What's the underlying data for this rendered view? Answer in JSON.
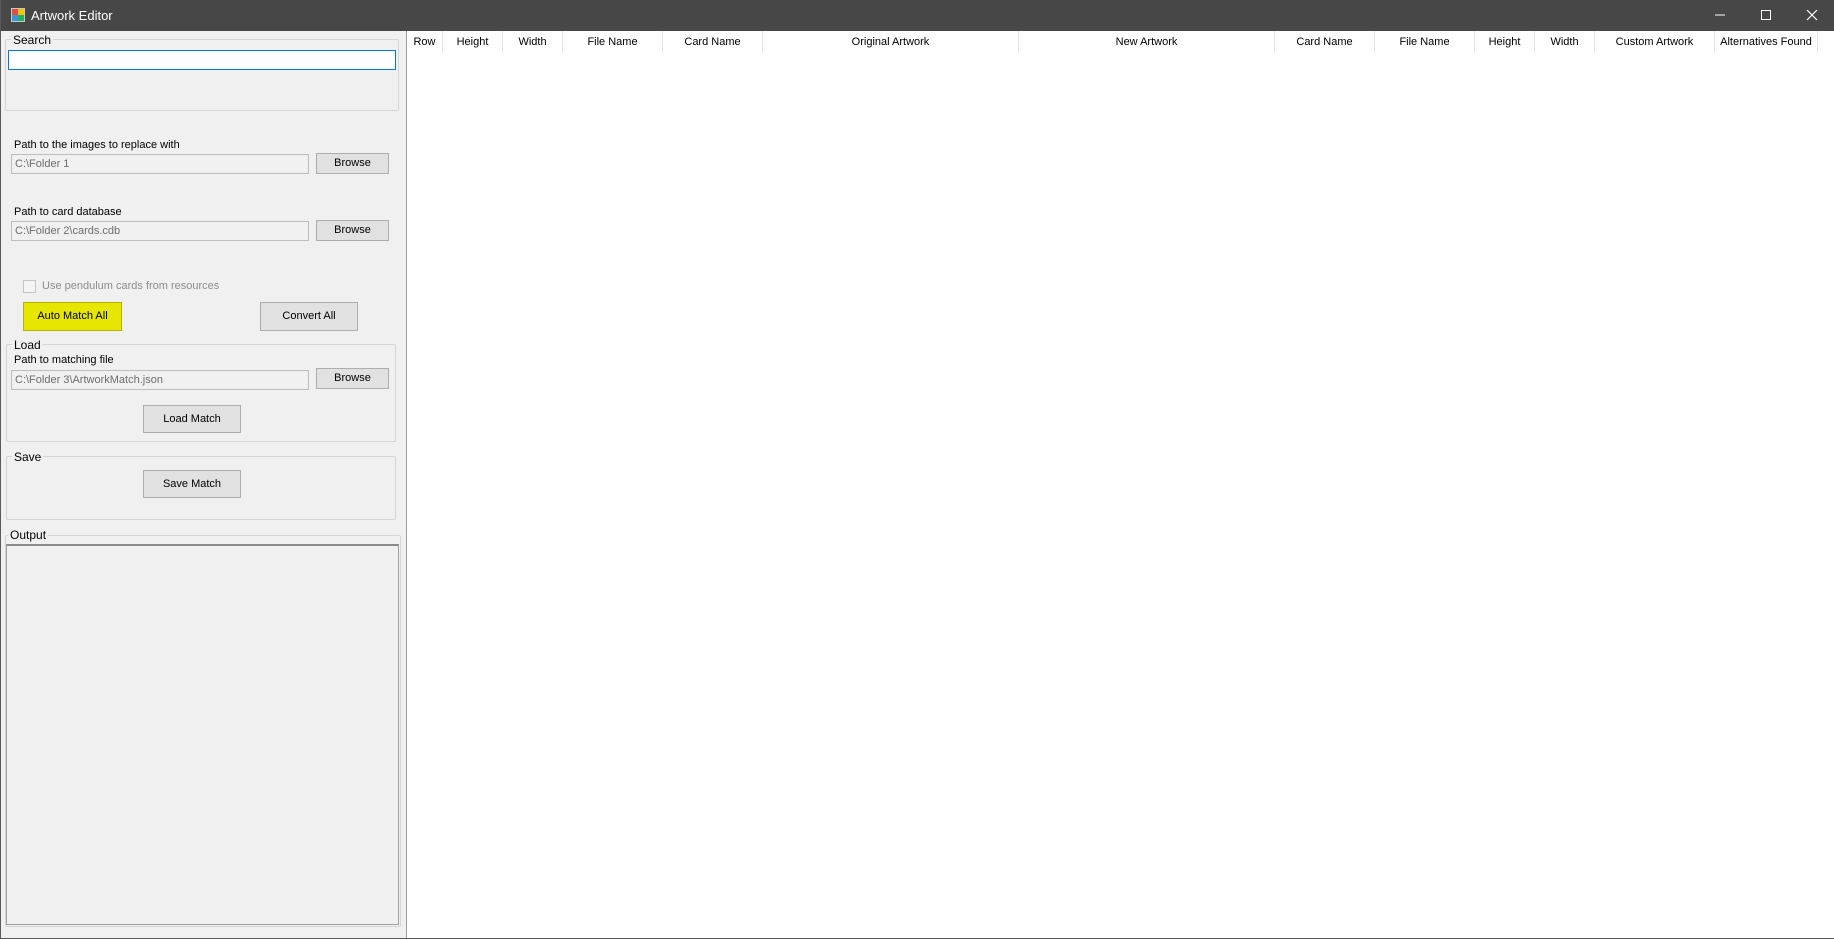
{
  "window": {
    "title": "Artwork Editor",
    "controls": [
      "minimize-icon",
      "maximize-icon",
      "close-icon"
    ]
  },
  "search": {
    "group_label": "Search",
    "value": ""
  },
  "images_path": {
    "label": "Path to the images to replace with",
    "value": "C:\\Folder 1",
    "browse_label": "Browse"
  },
  "card_db": {
    "label": "Path to card database",
    "value": "C:\\Folder 2\\cards.cdb",
    "browse_label": "Browse"
  },
  "pendulum": {
    "label": "Use pendulum cards from resources",
    "checked": false,
    "enabled": false
  },
  "actions": {
    "auto_match_label": "Auto Match All",
    "convert_label": "Convert All",
    "highlight_color": "#e6e600"
  },
  "load": {
    "group_label": "Load",
    "path_label": "Path to matching file",
    "value": "C:\\Folder 3\\ArtworkMatch.json",
    "browse_label": "Browse",
    "load_match_label": "Load Match"
  },
  "save": {
    "group_label": "Save",
    "save_match_label": "Save Match"
  },
  "output": {
    "group_label": "Output",
    "text": ""
  },
  "grid": {
    "columns": [
      "Row",
      "Height",
      "Width",
      "File Name",
      "Card Name",
      "Original Artwork",
      "New Artwork",
      "Card Name",
      "File Name",
      "Height",
      "Width",
      "Custom Artwork",
      "Alternatives Found"
    ]
  }
}
